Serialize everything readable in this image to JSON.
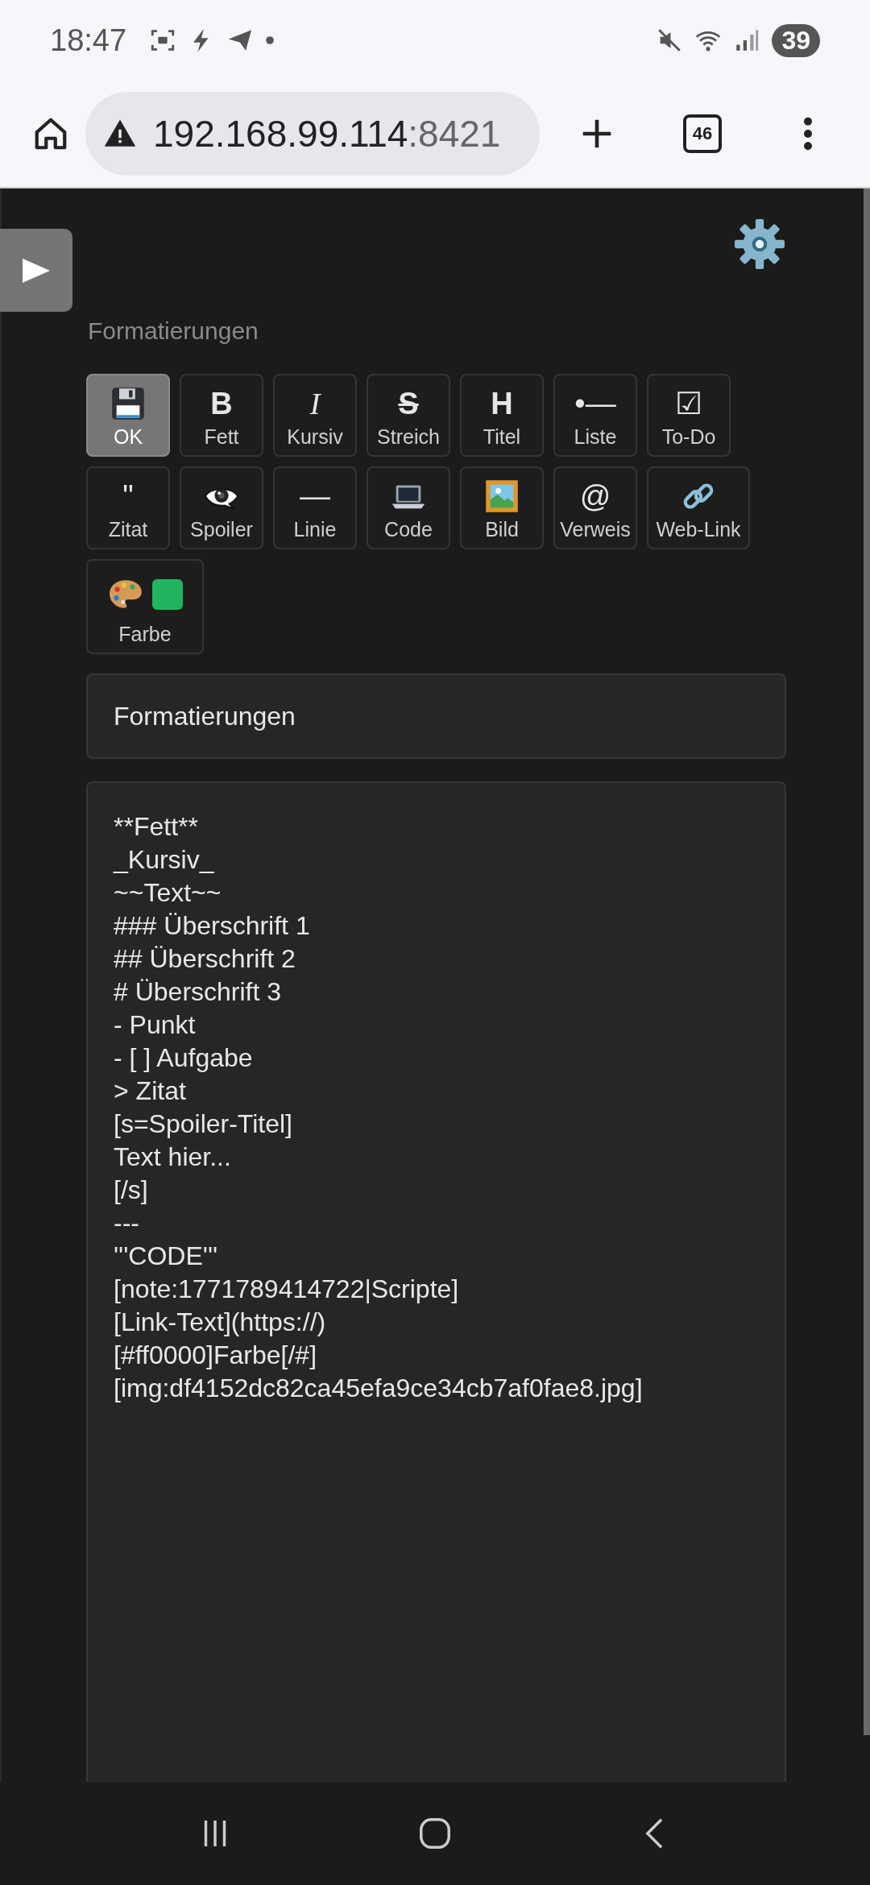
{
  "status_bar": {
    "time": "18:47",
    "battery": "39"
  },
  "browser": {
    "url_host": "192.168.99.114",
    "url_port": ":8421",
    "tab_count": "46"
  },
  "section_label": "Formatierungen",
  "toolbar": [
    {
      "kind": "floppy",
      "label": "OK",
      "selected": true
    },
    {
      "kind": "bold",
      "glyph": "B",
      "label": "Fett",
      "selected": false
    },
    {
      "kind": "italic",
      "glyph": "I",
      "label": "Kursiv",
      "selected": false
    },
    {
      "kind": "strike",
      "glyph": "S",
      "label": "Streich",
      "selected": false
    },
    {
      "kind": "bold",
      "glyph": "H",
      "label": "Titel",
      "selected": false
    },
    {
      "kind": "plain",
      "glyph": "•—",
      "label": "Liste",
      "selected": false
    },
    {
      "kind": "plain",
      "glyph": "☑",
      "label": "To-Do",
      "selected": false
    },
    {
      "kind": "plain",
      "glyph": "\"",
      "label": "Zitat",
      "selected": false
    },
    {
      "kind": "eye",
      "label": "Spoiler",
      "selected": false
    },
    {
      "kind": "plain",
      "glyph": "—",
      "label": "Linie",
      "selected": false
    },
    {
      "kind": "laptop",
      "label": "Code",
      "selected": false
    },
    {
      "kind": "image",
      "label": "Bild",
      "selected": false
    },
    {
      "kind": "plain",
      "glyph": "@",
      "label": "Verweis",
      "selected": false
    },
    {
      "kind": "link",
      "label": "Web-Link",
      "selected": false
    },
    {
      "kind": "palette",
      "label": "Farbe",
      "color": "#22b35f",
      "selected": false
    }
  ],
  "title_field": {
    "value": "Formatierungen"
  },
  "editor": {
    "lines": [
      "**Fett**",
      "_Kursiv_",
      "~~Text~~",
      "### Überschrift 1",
      "## Überschrift 2",
      "# Überschrift 3",
      "- Punkt",
      "- [ ] Aufgabe",
      "> Zitat",
      "[s=Spoiler-Titel]",
      "Text hier...",
      "[/s]",
      "---",
      "'''CODE'''",
      "[note:1771789414722|Scripte]",
      "[Link-Text](https://)",
      "[#ff0000]Farbe[/#]",
      "[img:df4152dc82ca45efa9ce34cb7af0fae8.jpg]"
    ]
  }
}
